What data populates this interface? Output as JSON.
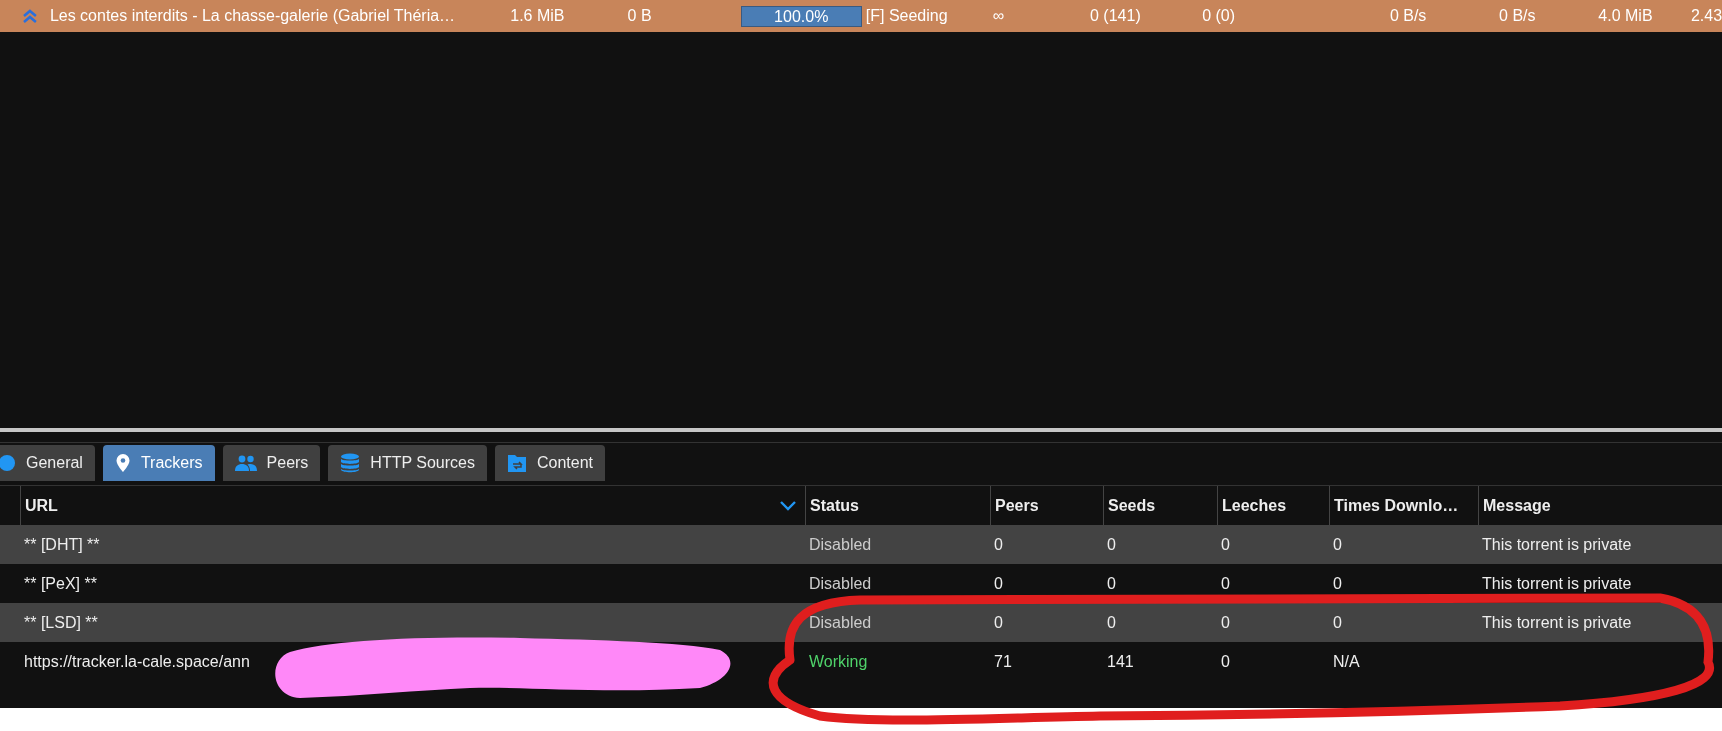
{
  "torrent_row": {
    "name": "Les contes interdits - La chasse-galerie (Gabriel Théria…",
    "size": "1.6 MiB",
    "remaining": "0 B",
    "progress_text": "100.0%",
    "level": 1.0,
    "status": "[F] Seeding",
    "eta": "∞",
    "seeds": "0 (141)",
    "peers": "0 (0)",
    "down_speed": "0 B/s",
    "up_speed": "0 B/s",
    "uploaded": "4.0 MiB",
    "ratio": "2.43"
  },
  "tabs": [
    {
      "label": "General",
      "kind": "info",
      "selected": false
    },
    {
      "label": "Trackers",
      "kind": "pin",
      "selected": true
    },
    {
      "label": "Peers",
      "kind": "people",
      "selected": false
    },
    {
      "label": "HTTP Sources",
      "kind": "database",
      "selected": false
    },
    {
      "label": "Content",
      "kind": "folder",
      "selected": false
    }
  ],
  "table": {
    "columns": [
      "URL",
      "Status",
      "Peers",
      "Seeds",
      "Leeches",
      "Times Downlo…",
      "Message"
    ],
    "rows": [
      {
        "url": "** [DHT] **",
        "status": "Disabled",
        "working": false,
        "peers": "0",
        "seeds": "0",
        "leeches": "0",
        "times": "0",
        "message": "This torrent is private"
      },
      {
        "url": "** [PeX] **",
        "status": "Disabled",
        "working": false,
        "peers": "0",
        "seeds": "0",
        "leeches": "0",
        "times": "0",
        "message": "This torrent is private"
      },
      {
        "url": "** [LSD] **",
        "status": "Disabled",
        "working": false,
        "peers": "0",
        "seeds": "0",
        "leeches": "0",
        "times": "0",
        "message": "This torrent is private"
      },
      {
        "url": "https://tracker.la-cale.space/ann",
        "status": "Working",
        "working": true,
        "peers": "71",
        "seeds": "141",
        "leeches": "0",
        "times": "N/A"
      }
    ]
  }
}
